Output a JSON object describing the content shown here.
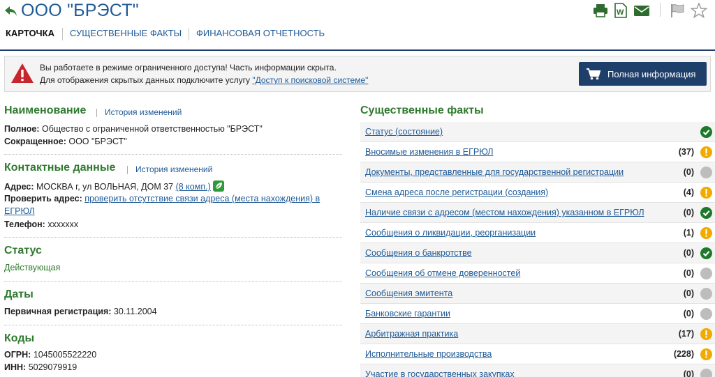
{
  "header": {
    "title": "ООО \"БРЭСТ\""
  },
  "toolbar": {
    "icons": [
      "print-icon",
      "word-icon",
      "mail-icon",
      "flag-icon",
      "star-icon"
    ]
  },
  "tabs": [
    {
      "label": "КАРТОЧКА",
      "active": true
    },
    {
      "label": "СУЩЕСТВЕННЫЕ ФАКТЫ",
      "active": false
    },
    {
      "label": "ФИНАНСОВАЯ ОТЧЕТНОСТЬ",
      "active": false
    }
  ],
  "notice": {
    "line1": "Вы работаете в режиме ограниченного доступа! Часть информации скрыта.",
    "line2_prefix": "Для отображения скрытых данных подключите услугу ",
    "line2_link": "\"Доступ к поисковой системе\"",
    "button_label": "Полная информация"
  },
  "naming": {
    "title": "Наименование",
    "history_link": "История изменений",
    "full_label": "Полное:",
    "full_value": "Общество с ограниченной ответственностью \"БРЭСТ\"",
    "short_label": "Сокращенное:",
    "short_value": "ООО \"БРЭСТ\""
  },
  "contacts": {
    "title": "Контактные данные",
    "history_link": "История изменений",
    "address_label": "Адрес:",
    "address_value": "МОСКВА г, ул ВОЛЬНАЯ, ДОМ 37",
    "companies_link": "(8 комп.)",
    "check_label": "Проверить адрес:",
    "check_link": "проверить отсутствие связи адреса (места нахождения) в ЕГРЮЛ",
    "phone_label": "Телефон:",
    "phone_value": "xxxxxxx"
  },
  "status": {
    "title": "Статус",
    "value": "Действующая"
  },
  "dates": {
    "title": "Даты",
    "reg_label": "Первичная регистрация:",
    "reg_value": "30.11.2004"
  },
  "codes": {
    "title": "Коды",
    "ogrn_label": "ОГРН:",
    "ogrn_value": "1045005522220",
    "inn_label": "ИНН:",
    "inn_value": "5029079919"
  },
  "facts": {
    "title": "Существенные факты",
    "rows": [
      {
        "label": "Статус (состояние)",
        "count": "",
        "status": "ok"
      },
      {
        "label": "Вносимые изменения в ЕГРЮЛ",
        "count": "(37)",
        "status": "warn"
      },
      {
        "label": "Документы, представленные для государственной регистрации",
        "count": "(0)",
        "status": "none"
      },
      {
        "label": "Смена адреса после регистрации (создания)",
        "count": "(4)",
        "status": "warn"
      },
      {
        "label": "Наличие связи с адресом (местом нахождения) указанном в ЕГРЮЛ",
        "count": "(0)",
        "status": "ok"
      },
      {
        "label": "Сообщения о ликвидации, реорганизации",
        "count": "(1)",
        "status": "warn"
      },
      {
        "label": "Сообщения о банкротстве",
        "count": "(0)",
        "status": "ok"
      },
      {
        "label": "Сообщения об отмене доверенностей",
        "count": "(0)",
        "status": "none"
      },
      {
        "label": "Сообщения эмитента",
        "count": "(0)",
        "status": "none"
      },
      {
        "label": "Банковские гарантии",
        "count": "(0)",
        "status": "none"
      },
      {
        "label": "Арбитражная практика",
        "count": "(17)",
        "status": "warn"
      },
      {
        "label": "Исполнительные производства",
        "count": "(228)",
        "status": "warn"
      },
      {
        "label": "Участие в государственных закупках",
        "count": "(0)",
        "status": "none"
      }
    ]
  },
  "colors": {
    "brand_blue": "#1f5a96",
    "navy": "#1f3f6b",
    "green": "#2f7a2f",
    "ok_green": "#1e7a2a",
    "warn_orange": "#f2a900",
    "none_gray": "#bdbdbd",
    "alert_red": "#c9252c"
  }
}
